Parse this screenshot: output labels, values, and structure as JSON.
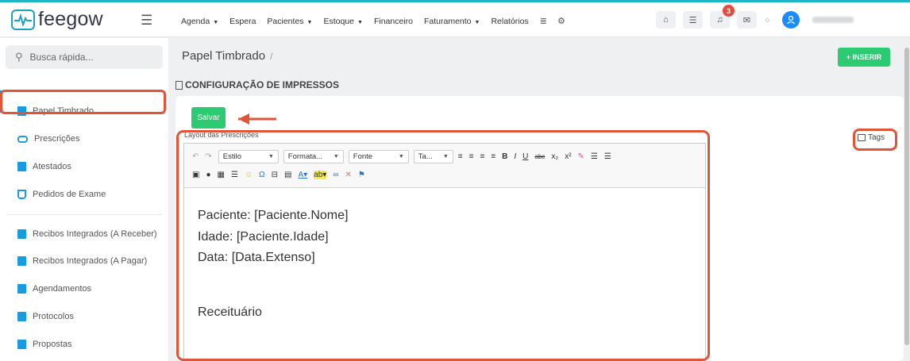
{
  "app": {
    "name": "feegow"
  },
  "nav": {
    "items": [
      {
        "label": "Agenda",
        "dropdown": true
      },
      {
        "label": "Espera",
        "dropdown": false
      },
      {
        "label": "Pacientes",
        "dropdown": true
      },
      {
        "label": "Estoque",
        "dropdown": true
      },
      {
        "label": "Financeiro",
        "dropdown": false
      },
      {
        "label": "Faturamento",
        "dropdown": true
      },
      {
        "label": "Relatórios",
        "dropdown": false
      }
    ],
    "notification_count": "3"
  },
  "search": {
    "placeholder": "Busca rápida..."
  },
  "sidebar": {
    "items": [
      {
        "label": "Papel Timbrado"
      },
      {
        "label": "Prescrições"
      },
      {
        "label": "Atestados"
      },
      {
        "label": "Pedidos de Exame"
      },
      {
        "label": "Recibos Integrados (A Receber)"
      },
      {
        "label": "Recibos Integrados (A Pagar)"
      },
      {
        "label": "Agendamentos"
      },
      {
        "label": "Protocolos"
      },
      {
        "label": "Propostas"
      }
    ]
  },
  "header": {
    "title": "Papel Timbrado",
    "separator": "/",
    "insert_label": "+ INSERIR"
  },
  "section": {
    "title": "CONFIGURAÇÃO DE IMPRESSOS"
  },
  "form": {
    "save_label": "Salvar",
    "field_label": "Layout das Prescrições",
    "tags_label": "Tags"
  },
  "editor": {
    "toolbar": {
      "estilo": "Estilo",
      "formata": "Formata...",
      "fonte": "Fonte",
      "tamanho": "Ta..."
    },
    "lines": {
      "l1": "Paciente: [Paciente.Nome]",
      "l2": "Idade: [Paciente.Idade]",
      "l3": "Data: [Data.Extenso]",
      "l4": "Receituário"
    }
  },
  "colors": {
    "brand": "#1aa2c0",
    "accent_green": "#2ccb73",
    "highlight": "#e05438",
    "link_blue": "#1a9be0"
  }
}
